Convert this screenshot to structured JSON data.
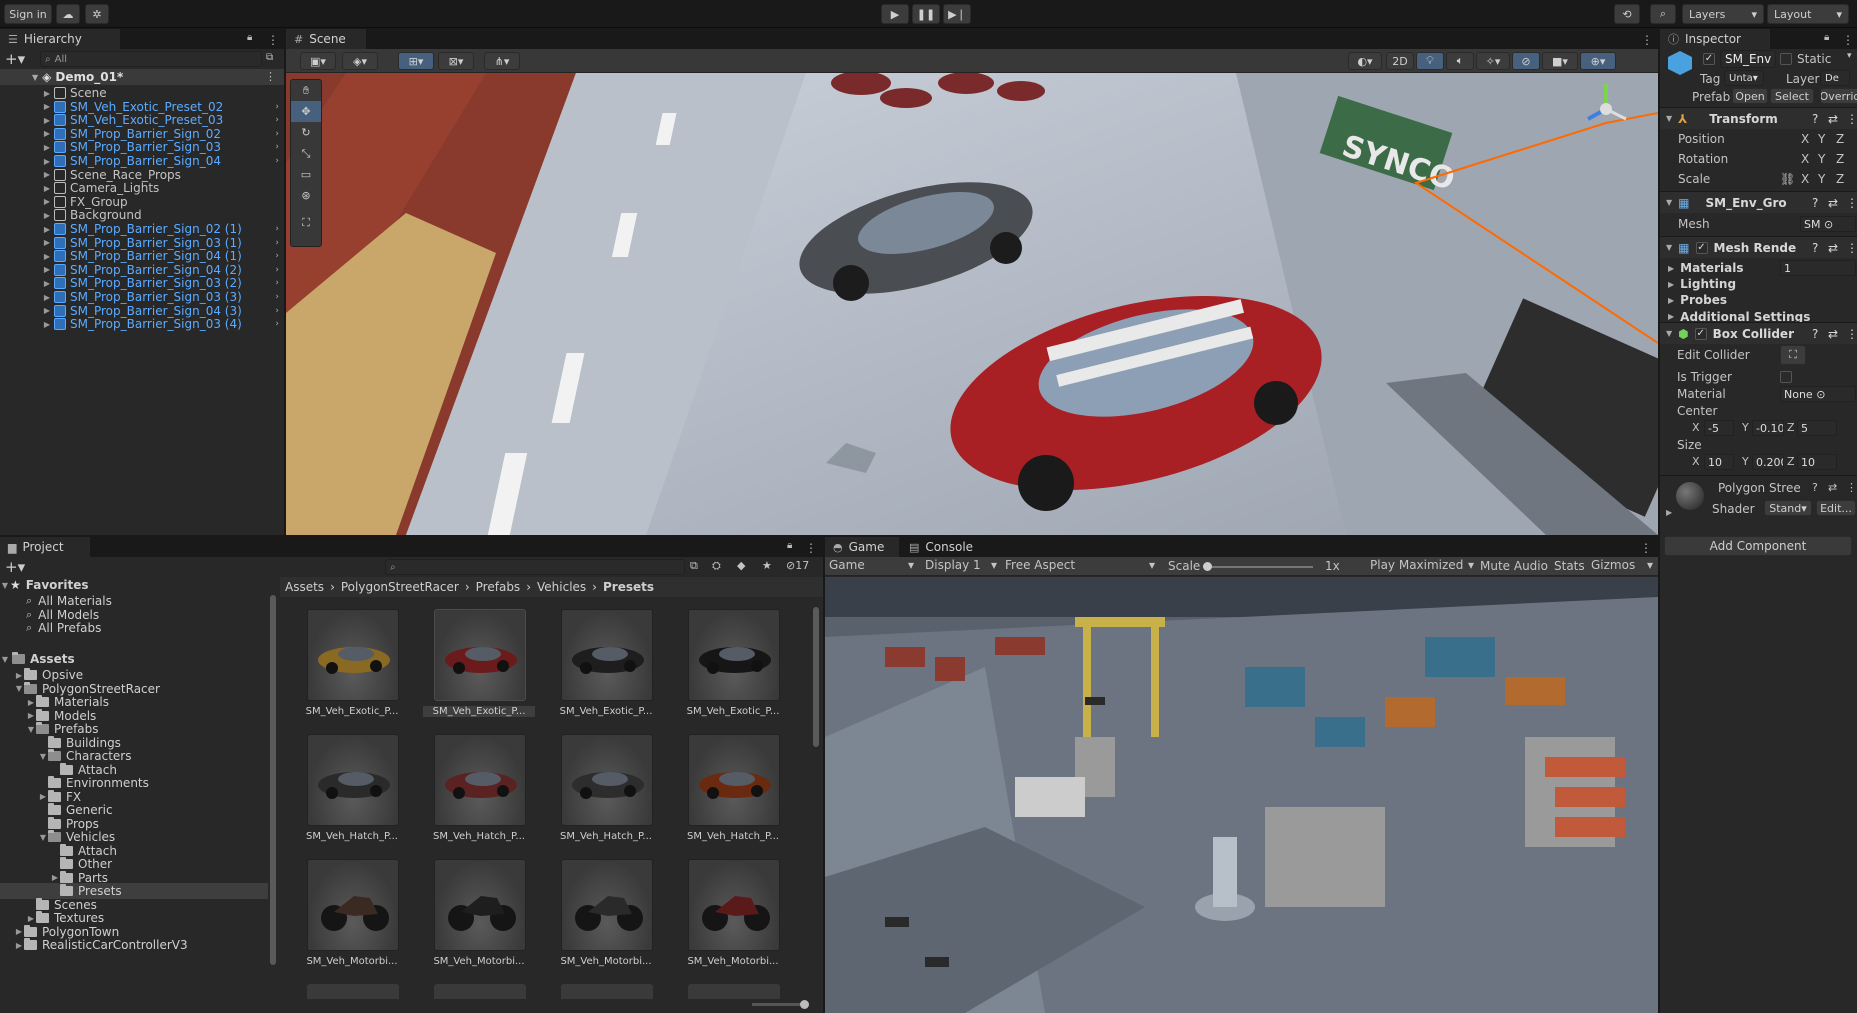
{
  "toolbar": {
    "sign_in": "Sign in",
    "layers": "Layers",
    "layout": "Layout"
  },
  "hierarchy": {
    "tab": "Hierarchy",
    "search_placeholder": "All",
    "scene_root": "Demo_01*",
    "items": [
      {
        "label": "Scene",
        "prefab": false
      },
      {
        "label": "SM_Veh_Exotic_Preset_02",
        "prefab": true
      },
      {
        "label": "SM_Veh_Exotic_Preset_03",
        "prefab": true
      },
      {
        "label": "SM_Prop_Barrier_Sign_02",
        "prefab": true
      },
      {
        "label": "SM_Prop_Barrier_Sign_03",
        "prefab": true
      },
      {
        "label": "SM_Prop_Barrier_Sign_04",
        "prefab": true
      },
      {
        "label": "Scene_Race_Props",
        "prefab": false
      },
      {
        "label": "Camera_Lights",
        "prefab": false
      },
      {
        "label": "FX_Group",
        "prefab": false
      },
      {
        "label": "Background",
        "prefab": false
      },
      {
        "label": "SM_Prop_Barrier_Sign_02 (1)",
        "prefab": true
      },
      {
        "label": "SM_Prop_Barrier_Sign_03 (1)",
        "prefab": true
      },
      {
        "label": "SM_Prop_Barrier_Sign_04 (1)",
        "prefab": true
      },
      {
        "label": "SM_Prop_Barrier_Sign_04 (2)",
        "prefab": true
      },
      {
        "label": "SM_Prop_Barrier_Sign_03 (2)",
        "prefab": true
      },
      {
        "label": "SM_Prop_Barrier_Sign_03 (3)",
        "prefab": true
      },
      {
        "label": "SM_Prop_Barrier_Sign_04 (3)",
        "prefab": true
      },
      {
        "label": "SM_Prop_Barrier_Sign_03 (4)",
        "prefab": true
      }
    ]
  },
  "scene": {
    "tab": "Scene",
    "btn_2d": "2D"
  },
  "project": {
    "tab": "Project",
    "hidden_count": "17",
    "breadcrumb": [
      "Assets",
      "PolygonStreetRacer",
      "Prefabs",
      "Vehicles",
      "Presets"
    ],
    "favorites_label": "Favorites",
    "favorites": [
      "All Materials",
      "All Models",
      "All Prefabs"
    ],
    "assets_label": "Assets",
    "tree": [
      {
        "label": "Opsive",
        "depth": 1,
        "arrow": "▶",
        "open": false
      },
      {
        "label": "PolygonStreetRacer",
        "depth": 1,
        "arrow": "▼",
        "open": true
      },
      {
        "label": "Materials",
        "depth": 2,
        "arrow": "▶",
        "open": false
      },
      {
        "label": "Models",
        "depth": 2,
        "arrow": "▶",
        "open": false
      },
      {
        "label": "Prefabs",
        "depth": 2,
        "arrow": "▼",
        "open": true
      },
      {
        "label": "Buildings",
        "depth": 3,
        "arrow": "",
        "open": false
      },
      {
        "label": "Characters",
        "depth": 3,
        "arrow": "▼",
        "open": true
      },
      {
        "label": "Attach",
        "depth": 4,
        "arrow": "",
        "open": false
      },
      {
        "label": "Environments",
        "depth": 3,
        "arrow": "",
        "open": false
      },
      {
        "label": "FX",
        "depth": 3,
        "arrow": "▶",
        "open": false
      },
      {
        "label": "Generic",
        "depth": 3,
        "arrow": "",
        "open": false
      },
      {
        "label": "Props",
        "depth": 3,
        "arrow": "",
        "open": false
      },
      {
        "label": "Vehicles",
        "depth": 3,
        "arrow": "▼",
        "open": true
      },
      {
        "label": "Attach",
        "depth": 4,
        "arrow": "",
        "open": false
      },
      {
        "label": "Other",
        "depth": 4,
        "arrow": "",
        "open": false
      },
      {
        "label": "Parts",
        "depth": 4,
        "arrow": "▶",
        "open": false
      },
      {
        "label": "Presets",
        "depth": 4,
        "arrow": "",
        "open": false
      },
      {
        "label": "Scenes",
        "depth": 2,
        "arrow": "",
        "open": false
      },
      {
        "label": "Textures",
        "depth": 2,
        "arrow": "▶",
        "open": false
      },
      {
        "label": "PolygonTown",
        "depth": 1,
        "arrow": "▶",
        "open": false
      },
      {
        "label": "RealisticCarControllerV3",
        "depth": 1,
        "arrow": "▶",
        "open": false
      }
    ],
    "assets": [
      {
        "label": "SM_Veh_Exotic_P...",
        "color": "#8a6a22"
      },
      {
        "label": "SM_Veh_Exotic_P...",
        "color": "#6b1b1b"
      },
      {
        "label": "SM_Veh_Exotic_P...",
        "color": "#1e1e1e"
      },
      {
        "label": "SM_Veh_Exotic_P...",
        "color": "#161616"
      },
      {
        "label": "SM_Veh_Hatch_P...",
        "color": "#2a2a2a"
      },
      {
        "label": "SM_Veh_Hatch_P...",
        "color": "#5b2222"
      },
      {
        "label": "SM_Veh_Hatch_P...",
        "color": "#2d2d2d"
      },
      {
        "label": "SM_Veh_Hatch_P...",
        "color": "#6a2a10"
      },
      {
        "label": "SM_Veh_Motorbi...",
        "color": "#3a2a22"
      },
      {
        "label": "SM_Veh_Motorbi...",
        "color": "#1e1e1e"
      },
      {
        "label": "SM_Veh_Motorbi...",
        "color": "#2a2a2a"
      },
      {
        "label": "SM_Veh_Motorbi...",
        "color": "#5a1a1a"
      }
    ]
  },
  "game": {
    "tab_game": "Game",
    "tab_console": "Console",
    "view_mode": "Game",
    "display": "Display 1",
    "aspect": "Free Aspect",
    "scale_label": "Scale",
    "scale_value": "1x",
    "play_mode": "Play Maximized",
    "mute": "Mute Audio",
    "stats": "Stats",
    "gizmos": "Gizmos"
  },
  "inspector": {
    "tab": "Inspector",
    "object_name": "SM_Env",
    "static_label": "Static",
    "tag_label": "Tag",
    "tag_value": "Unta",
    "layer_label": "Layer",
    "layer_value": "De",
    "prefab_label": "Prefab",
    "prefab_open": "Open",
    "prefab_select": "Select",
    "prefab_overrides": "Overrid",
    "transform": {
      "title": "Transform",
      "position": "Position",
      "rotation": "Rotation",
      "scale": "Scale",
      "x": "X",
      "y": "Y",
      "z": "Z"
    },
    "mesh_filter": {
      "title": "SM_Env_Gro",
      "mesh_label": "Mesh",
      "mesh_value": "SM"
    },
    "mesh_renderer": {
      "title": "Mesh Rende",
      "groups": [
        "Materials",
        "Lighting",
        "Probes",
        "Additional Settings"
      ],
      "materials_count": "1"
    },
    "box_collider": {
      "title": "Box Collider",
      "edit_collider": "Edit Collider",
      "is_trigger": "Is Trigger",
      "material_label": "Material",
      "material_value": "None",
      "center_label": "Center",
      "center": {
        "x": "-5",
        "y": "-0.10",
        "z": "5"
      },
      "size_label": "Size",
      "size": {
        "x": "10",
        "y": "0.200",
        "z": "10"
      }
    },
    "material": {
      "name": "Polygon Stree",
      "shader_label": "Shader",
      "shader_value": "Stand",
      "edit": "Edit..."
    },
    "add_component": "Add Component"
  }
}
